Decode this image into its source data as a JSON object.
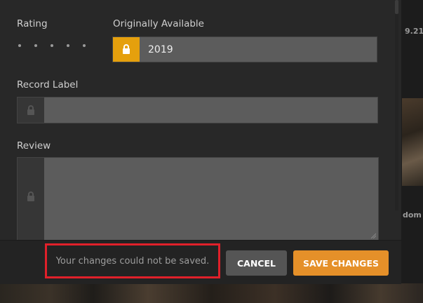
{
  "background": {
    "side_text_1": "9.21",
    "side_text_2": "dom"
  },
  "form": {
    "rating": {
      "label": "Rating",
      "stars_filled": 0,
      "stars_total": 5
    },
    "originally_available": {
      "label": "Originally Available",
      "value": "2019",
      "locked": true
    },
    "record_label": {
      "label": "Record Label",
      "value": "",
      "locked": false
    },
    "review": {
      "label": "Review",
      "value": "",
      "locked": false
    }
  },
  "footer": {
    "error_message": "Your changes could not be saved.",
    "cancel_label": "CANCEL",
    "save_label": "SAVE CHANGES"
  },
  "colors": {
    "accent": "#e59029",
    "lock_active": "#e5a00d",
    "error_outline": "#e0202a"
  },
  "icons": {
    "lock": "lock-icon"
  }
}
